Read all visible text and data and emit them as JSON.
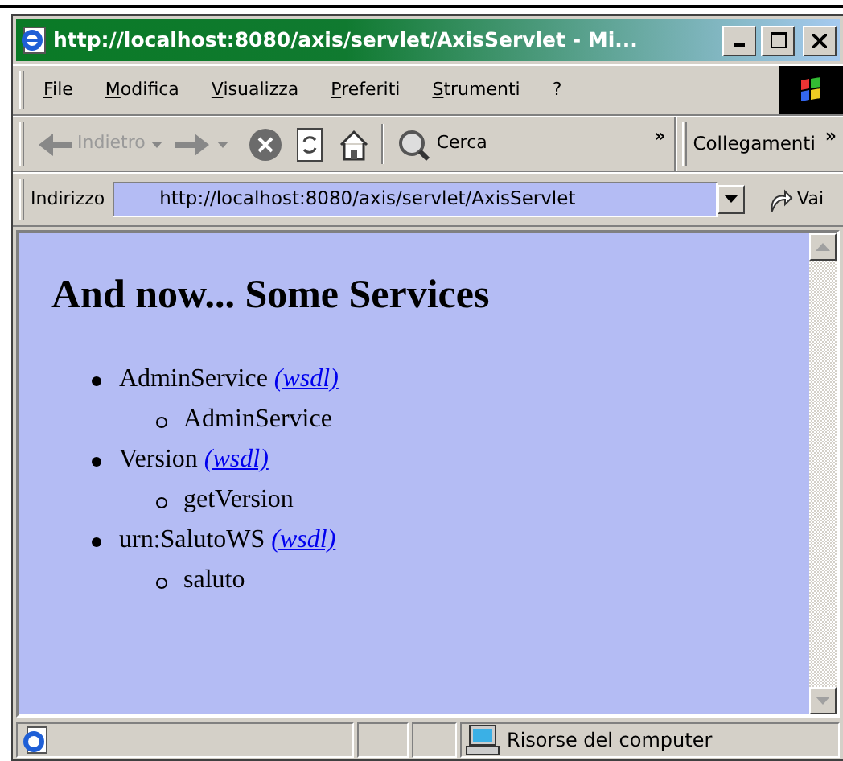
{
  "window": {
    "title": "http://localhost:8080/axis/servlet/AxisServlet - Mi..."
  },
  "menu": [
    {
      "label": "File"
    },
    {
      "label": "Modifica"
    },
    {
      "label": "Visualizza"
    },
    {
      "label": "Preferiti"
    },
    {
      "label": "Strumenti"
    },
    {
      "label": "?"
    }
  ],
  "toolbar": {
    "back": {
      "label": "Indietro",
      "disabled": true
    },
    "search": {
      "label": "Cerca"
    },
    "more": "»",
    "links": "Collegamenti",
    "links_more": "»"
  },
  "address": {
    "label": "Indirizzo",
    "value": "http://localhost:8080/axis/servlet/AxisServlet",
    "go": "Vai"
  },
  "page": {
    "heading": "And now... Some Services",
    "services": [
      {
        "name": "AdminService",
        "link": "(wsdl)",
        "methods": [
          "AdminService"
        ]
      },
      {
        "name": "Version",
        "link": "(wsdl)",
        "methods": [
          "getVersion"
        ]
      },
      {
        "name": "urn:SalutoWS",
        "link": "(wsdl)",
        "methods": [
          "saluto"
        ]
      }
    ]
  },
  "status_bar": {
    "zone": "Risorse del computer"
  }
}
